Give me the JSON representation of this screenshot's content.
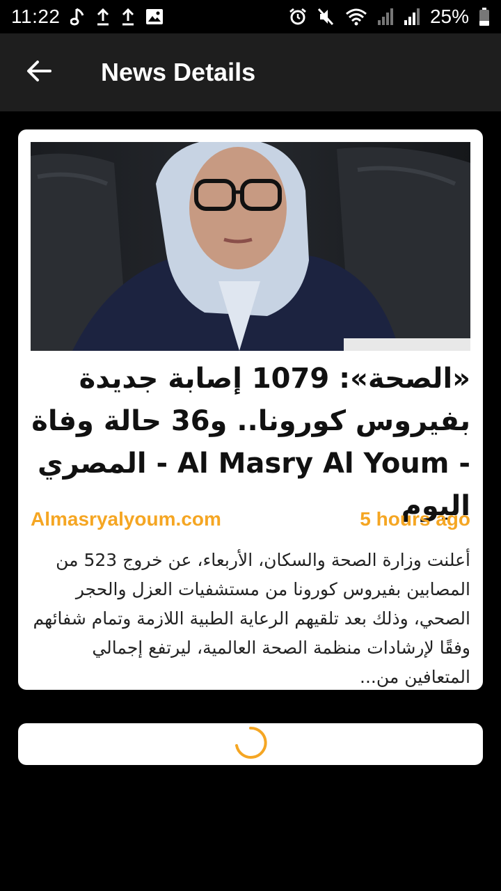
{
  "status_bar": {
    "time": "11:22",
    "battery": "25%",
    "left_icons": [
      "music-note-icon",
      "upload-icon",
      "upload-icon",
      "image-icon"
    ],
    "right_icons": [
      "alarm-icon",
      "mute-icon",
      "wifi-icon",
      "signal-icon",
      "signal-icon",
      "battery-icon"
    ]
  },
  "app_bar": {
    "title": "News Details",
    "back_icon": "arrow-left-icon"
  },
  "article": {
    "title": "«الصحة»: 1079 إصابة جديدة بفيروس كورونا.. و36 حالة وفاة - Al Masry Al Youm - المصري اليوم",
    "source": "Almasryalyoum.com",
    "time_ago": "5 hours ago",
    "description": "أعلنت وزارة الصحة والسكان، الأربعاء، عن خروج 523 من المصابين بفيروس كورونا من مستشفيات العزل والحجر الصحي، وذلك بعد تلقيهم الرعاية الطبية اللازمة وتمام شفائهم وفقًا لإرشادات منظمة الصحة العالمية، ليرتفع إجمالي المتعافين من..."
  },
  "colors": {
    "accent": "#f5a623",
    "app_bar": "#1e1e1e",
    "background": "#000000",
    "card": "#ffffff"
  },
  "loader": {
    "icon": "loading-spinner-icon"
  }
}
